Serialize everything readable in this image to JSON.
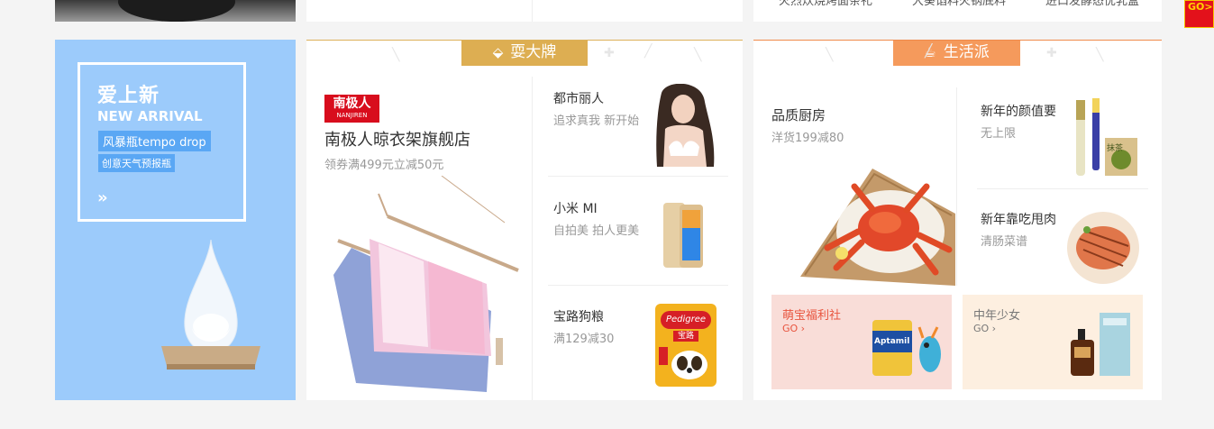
{
  "top_strip": {
    "cut_items": [
      "火烈炊烧烤面条礼",
      "大葵馅料火锅底料",
      "进口发酵态优乳盒"
    ],
    "go_badge": "GO>"
  },
  "promo": {
    "title_cn": "爱上新",
    "title_en": "NEW ARRIVAL",
    "tag1": "风暴瓶tempo drop",
    "tag2": "创意天气预报瓶",
    "arrows": "»"
  },
  "brand_panel": {
    "tab_label": "耍大牌",
    "tab_icon": "tag-icon",
    "store": {
      "logo_text": "南极人",
      "logo_sub": "NANJIREN",
      "title": "南极人晾衣架旗舰店",
      "subtitle": "领券满499元立减50元"
    },
    "items": [
      {
        "title": "都市丽人",
        "subtitle": "追求真我 新开始"
      },
      {
        "title": "小米 MI",
        "subtitle": "自拍美 拍人更美"
      },
      {
        "title": "宝路狗粮",
        "subtitle": "满129减30"
      }
    ],
    "pedigree_label": "Pedigree",
    "pedigree_badge": "宝路"
  },
  "life_panel": {
    "tab_label": "生活派",
    "tab_icon": "cup-icon",
    "feature": {
      "title": "品质厨房",
      "subtitle": "洋货199减80"
    },
    "items": [
      {
        "title": "新年的颜值要",
        "subtitle": "无上限"
      },
      {
        "title": "新年靠吃甩肉",
        "subtitle": "清肠菜谱"
      }
    ],
    "matcha_label": "抹茶",
    "minis": [
      {
        "title": "萌宝福利社",
        "go": "GO ›",
        "product_label": "Aptamil"
      },
      {
        "title": "中年少女",
        "go": "GO ›"
      }
    ]
  },
  "colors": {
    "brand_tab": "#ddae52",
    "life_tab": "#f59a5c",
    "promo_bg": "#9ccbfb",
    "mini_pink": "#f9ddd8",
    "mini_cream": "#fdefe0"
  }
}
